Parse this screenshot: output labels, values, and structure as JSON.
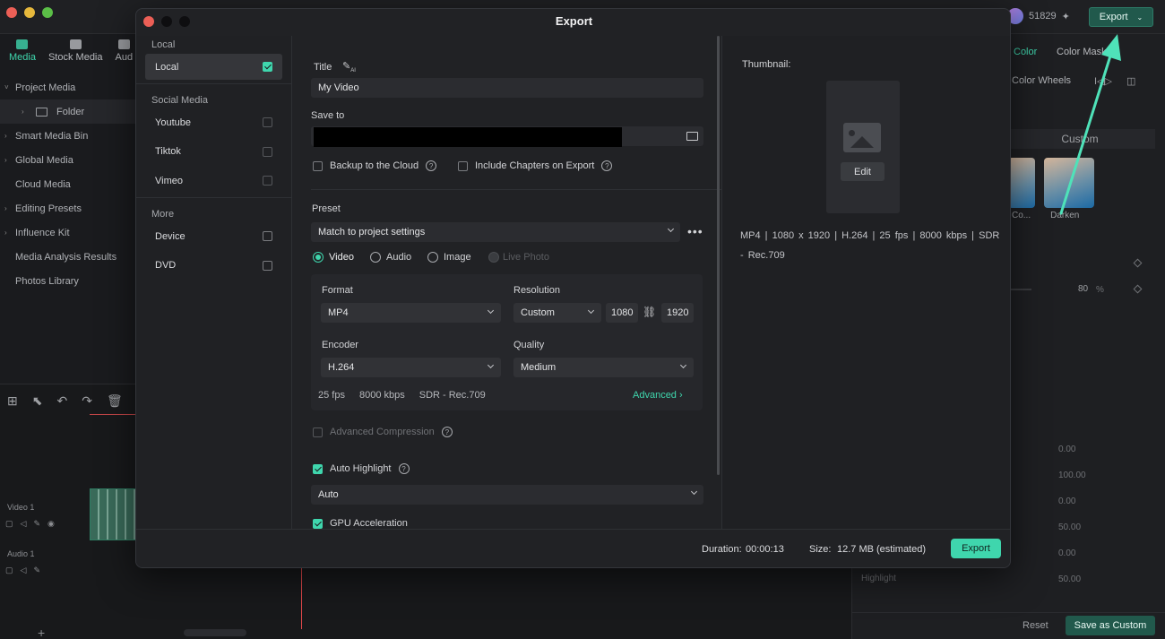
{
  "app": {
    "user_count": "51829",
    "export_label": "Export",
    "left_tabs": [
      {
        "label": "Media",
        "icon": "media-icon"
      },
      {
        "label": "Stock Media",
        "icon": "stock-media-icon"
      },
      {
        "label": "Aud",
        "icon": "audio-icon"
      }
    ],
    "media_tree": [
      {
        "label": "Project Media",
        "chevron": "˅"
      },
      {
        "label": "Folder",
        "chevron": "›"
      },
      {
        "label": "Smart Media Bin",
        "chevron": "›"
      },
      {
        "label": "Global Media",
        "chevron": "›"
      },
      {
        "label": "Cloud Media",
        "chevron": ""
      },
      {
        "label": "Editing Presets",
        "chevron": "›"
      },
      {
        "label": "Influence Kit",
        "chevron": "›"
      },
      {
        "label": "Media Analysis Results",
        "chevron": ""
      },
      {
        "label": "Photos Library",
        "chevron": ""
      }
    ],
    "timeline": {
      "video_track": "Video 1",
      "audio_track": "Audio 1"
    },
    "right_panel": {
      "tab_color": "Color",
      "tab_mask": "Color Mask",
      "sub_tab": "Color Wheels",
      "custom_tab": "Custom",
      "thumb_labels": [
        "Co...",
        "Darken"
      ],
      "value_80": "80",
      "percent": "%",
      "values": [
        "0.00",
        "100.00",
        "0.00",
        "50.00",
        "0.00",
        "50.00"
      ],
      "highlight": "Highlight",
      "reset": "Reset",
      "save_custom": "Save as Custom"
    }
  },
  "modal": {
    "title": "Export",
    "sidebar": {
      "local_section": "Local",
      "local_item": "Local",
      "social_section": "Social Media",
      "social_items": [
        "Youtube",
        "Tiktok",
        "Vimeo"
      ],
      "more_section": "More",
      "more_items": [
        "Device",
        "DVD"
      ]
    },
    "form": {
      "title_label": "Title",
      "title_value": "My Video",
      "save_to_label": "Save to",
      "backup_label": "Backup to the Cloud",
      "chapters_label": "Include Chapters on Export",
      "preset_label": "Preset",
      "preset_value": "Match to project settings",
      "radio_video": "Video",
      "radio_audio": "Audio",
      "radio_image": "Image",
      "radio_live": "Live Photo",
      "format_label": "Format",
      "format_value": "MP4",
      "resolution_label": "Resolution",
      "resolution_value": "Custom",
      "width": "1080",
      "height": "1920",
      "encoder_label": "Encoder",
      "encoder_value": "H.264",
      "quality_label": "Quality",
      "quality_value": "Medium",
      "summary_fps": "25 fps",
      "summary_kbps": "8000 kbps",
      "summary_sdr": "SDR - Rec.709",
      "advanced": "Advanced",
      "adv_compression": "Advanced Compression",
      "auto_highlight": "Auto Highlight",
      "auto_value": "Auto",
      "gpu": "GPU Acceleration"
    },
    "thumbnail": {
      "label": "Thumbnail:",
      "edit": "Edit",
      "spec": "MP4   |   1080 x 1920   |   H.264   |   25 fps   |   8000 kbps   |   SDR - Rec.709"
    },
    "footer": {
      "duration_label": "Duration:",
      "duration_value": "00:00:13",
      "size_label": "Size:",
      "size_value": "12.7 MB",
      "size_note": "(estimated)",
      "export_label": "Export"
    }
  },
  "colors": {
    "accent": "#3fd6ad",
    "annotation_arrow": "#4fe2b9"
  }
}
